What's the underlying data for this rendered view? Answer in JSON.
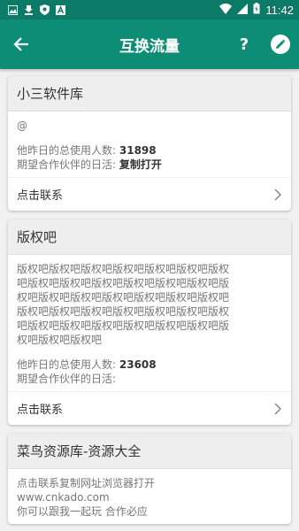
{
  "status_bar": {
    "time": "11:42",
    "icons": [
      "image-icon",
      "download-icon",
      "shield-icon",
      "text-icon",
      "wifi-icon",
      "signal-icon",
      "battery-icon"
    ]
  },
  "app_bar": {
    "title": "互换流量",
    "help_label": "?"
  },
  "cards": [
    {
      "title": "小三软件库",
      "desc": "@",
      "users_label": "他昨日的总使用人数:",
      "users_value": "31898",
      "partner_label": "期望合作伙伴的日活:",
      "partner_value": "复制打开",
      "footer": "点击联系"
    },
    {
      "title": "版权吧",
      "desc": "版权吧版权吧版权吧版权吧版权吧版权吧版权吧版权吧版权吧版权吧版权吧版权吧版权吧版权吧版权吧版权吧版权吧版权吧版权吧版权吧版权吧版权吧版权吧版权吧版权吧版权吧版权吧版权吧版权吧版权吧版权吧版权吧版权吧版权吧版权吧版权吧",
      "users_label": "他昨日的总使用人数:",
      "users_value": "23608",
      "partner_label": "期望合作伙伴的日活:",
      "partner_value": "",
      "footer": "点击联系"
    },
    {
      "title": "菜鸟资源库-资源大全",
      "desc_lines": [
        "点击联系复制网址浏览器打开",
        "www.cnkado.com",
        "你可以跟我一起玩 合作必应"
      ]
    }
  ],
  "colors": {
    "status_bar": "#0b7a66",
    "app_bar": "#0d8d76",
    "background": "#f1f1f1"
  }
}
